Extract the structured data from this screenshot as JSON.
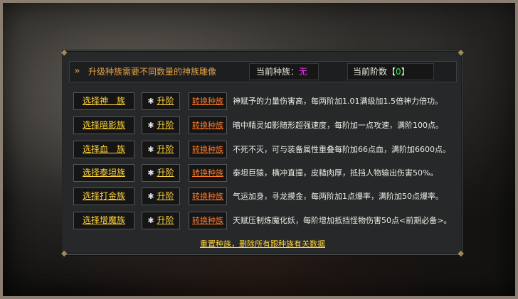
{
  "header": {
    "notice": "升级种族需要不同数量的神族雕像",
    "current_race_label": "当前种族：",
    "current_race_value": "无",
    "current_tier_label": "当前阶数【",
    "current_tier_value": "0",
    "current_tier_suffix": "】"
  },
  "rows": [
    {
      "select": "选择神　族",
      "upgrade": "升阶",
      "convert": "转换种族",
      "desc": "神赋予的力量伤害高，每两阶加1.01满级加1.5倍神力倍功。"
    },
    {
      "select": "选择暗影族",
      "upgrade": "升阶",
      "convert": "转换种族",
      "desc": "暗中精灵如影随形超强速度，每阶加一点攻速，满阶100点。"
    },
    {
      "select": "选择血　族",
      "upgrade": "升阶",
      "convert": "转换种族",
      "desc": "不死不灭，可与装备属性重叠每阶加66点血，满阶加6600点。"
    },
    {
      "select": "选择泰坦族",
      "upgrade": "升阶",
      "convert": "转换种族",
      "desc": "泰坦巨猿，横冲直撞，皮糙肉厚，抵挡人物输出伤害50%。"
    },
    {
      "select": "选择打金族",
      "upgrade": "升阶",
      "convert": "转换种族",
      "desc": "气运加身，寻龙摸金，每两阶加1点爆率，满阶加50点爆率。"
    },
    {
      "select": "选择增魔族",
      "upgrade": "升阶",
      "convert": "转换种族",
      "desc": "天赋压制炼魔化妖，每阶增加抵挡怪物伤害50点<前期必备>。"
    }
  ],
  "reset_label": "重置种族，删除所有跟种族有关数据",
  "colors": {
    "accent_gold": "#ffd23a",
    "convert_orange": "#ff7a2a",
    "race_magenta": "#ff2df5",
    "tier_green": "#39e44a"
  },
  "icons": {
    "notice": "double-chevron-right-icon",
    "upgrade_marker": "star-icon"
  }
}
